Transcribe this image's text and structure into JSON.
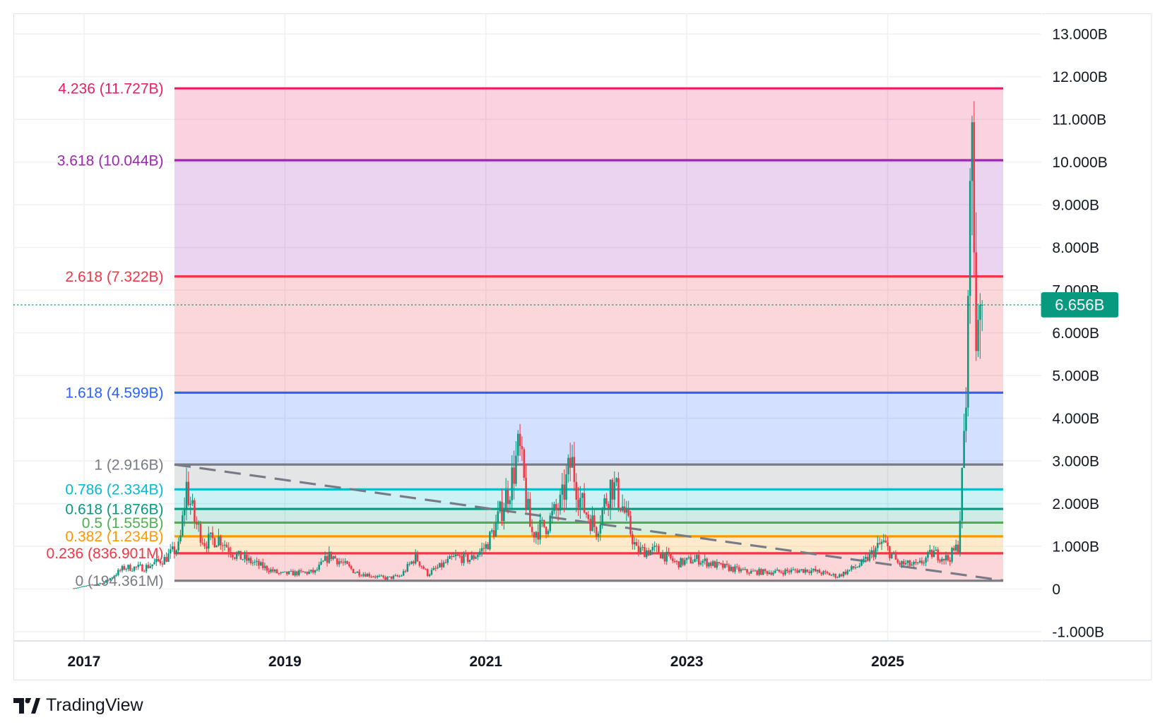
{
  "chart_data": {
    "type": "candlestick",
    "y_axis": {
      "ticks": [
        "13.000B",
        "12.000B",
        "11.000B",
        "10.000B",
        "9.000B",
        "8.000B",
        "7.000B",
        "6.000B",
        "5.000B",
        "4.000B",
        "3.000B",
        "2.000B",
        "1.000B",
        "0",
        "-1.000B"
      ],
      "tick_values": [
        13,
        12,
        11,
        10,
        9,
        8,
        7,
        6,
        5,
        4,
        3,
        2,
        1,
        0,
        -1
      ],
      "range": [
        -1.2,
        13.3
      ],
      "unit": "B"
    },
    "x_axis": {
      "ticks": [
        "2017",
        "2019",
        "2021",
        "2023",
        "2025"
      ],
      "tick_values": [
        2017,
        2019,
        2021,
        2023,
        2025
      ],
      "range": [
        2016.5,
        2026.6
      ]
    },
    "grid": true,
    "last_price": {
      "label": "6.656B",
      "value": 6.656,
      "color": "#089981"
    },
    "price_path": [
      [
        2016.9,
        0.02
      ],
      [
        2017.2,
        0.15
      ],
      [
        2017.4,
        0.5
      ],
      [
        2017.6,
        0.5
      ],
      [
        2017.8,
        0.7
      ],
      [
        2017.95,
        1.0
      ],
      [
        2018.02,
        2.4
      ],
      [
        2018.1,
        1.6
      ],
      [
        2018.2,
        1.1
      ],
      [
        2018.35,
        1.2
      ],
      [
        2018.5,
        0.8
      ],
      [
        2018.7,
        0.6
      ],
      [
        2018.95,
        0.35
      ],
      [
        2019.3,
        0.4
      ],
      [
        2019.45,
        0.8
      ],
      [
        2019.7,
        0.4
      ],
      [
        2020.0,
        0.25
      ],
      [
        2020.15,
        0.3
      ],
      [
        2020.3,
        0.75
      ],
      [
        2020.42,
        0.35
      ],
      [
        2020.7,
        0.75
      ],
      [
        2020.85,
        0.7
      ],
      [
        2021.0,
        1.0
      ],
      [
        2021.1,
        1.5
      ],
      [
        2021.25,
        2.5
      ],
      [
        2021.33,
        3.3
      ],
      [
        2021.45,
        1.3
      ],
      [
        2021.6,
        1.5
      ],
      [
        2021.75,
        2.0
      ],
      [
        2021.85,
        3.0
      ],
      [
        2021.95,
        2.0
      ],
      [
        2022.1,
        1.4
      ],
      [
        2022.25,
        2.5
      ],
      [
        2022.35,
        2.0
      ],
      [
        2022.5,
        0.9
      ],
      [
        2022.7,
        0.9
      ],
      [
        2022.9,
        0.6
      ],
      [
        2023.1,
        0.7
      ],
      [
        2023.3,
        0.55
      ],
      [
        2023.6,
        0.4
      ],
      [
        2023.9,
        0.4
      ],
      [
        2024.2,
        0.45
      ],
      [
        2024.5,
        0.3
      ],
      [
        2024.75,
        0.6
      ],
      [
        2024.95,
        1.1
      ],
      [
        2025.1,
        0.6
      ],
      [
        2025.3,
        0.55
      ],
      [
        2025.45,
        0.85
      ],
      [
        2025.6,
        0.7
      ],
      [
        2025.7,
        1.0
      ],
      [
        2025.74,
        2.5
      ],
      [
        2025.78,
        4.5
      ],
      [
        2025.8,
        6.0
      ],
      [
        2025.82,
        11.5
      ],
      [
        2025.85,
        9.0
      ],
      [
        2025.88,
        6.0
      ],
      [
        2025.91,
        7.0
      ],
      [
        2025.94,
        6.656
      ]
    ],
    "fib_levels": [
      {
        "ratio": 4.236,
        "price": 11.727,
        "label": "4.236 (11.727B)",
        "color": "#e91e63"
      },
      {
        "ratio": 3.618,
        "price": 10.044,
        "label": "3.618 (10.044B)",
        "color": "#9c27b0"
      },
      {
        "ratio": 2.618,
        "price": 7.322,
        "label": "2.618 (7.322B)",
        "color": "#f23645"
      },
      {
        "ratio": 1.618,
        "price": 4.599,
        "label": "1.618 (4.599B)",
        "color": "#2962ff"
      },
      {
        "ratio": 1,
        "price": 2.916,
        "label": "1 (2.916B)",
        "color": "#787b86"
      },
      {
        "ratio": 0.786,
        "price": 2.334,
        "label": "0.786 (2.334B)",
        "color": "#00bcd4"
      },
      {
        "ratio": 0.618,
        "price": 1.876,
        "label": "0.618 (1.876B)",
        "color": "#089981"
      },
      {
        "ratio": 0.5,
        "price": 1.555,
        "label": "0.5 (1.555B)",
        "color": "#4caf50"
      },
      {
        "ratio": 0.382,
        "price": 1.234,
        "label": "0.382 (1.234B)",
        "color": "#ff9800"
      },
      {
        "ratio": 0.236,
        "price": 0.837,
        "label": "0.236 (836.901M)",
        "color": "#f23645"
      },
      {
        "ratio": 0,
        "price": 0.194,
        "label": "0 (194.361M)",
        "color": "#787b86"
      }
    ],
    "fib_range": [
      2017.9,
      2026.15
    ],
    "trend_line": {
      "from": [
        2017.9,
        2.916
      ],
      "to": [
        2026.15,
        0.2
      ],
      "style": "dashed",
      "color": "#787b86"
    },
    "colors": {
      "up": "#089981",
      "down": "#f23645"
    }
  },
  "branding": {
    "name": "TradingView"
  }
}
